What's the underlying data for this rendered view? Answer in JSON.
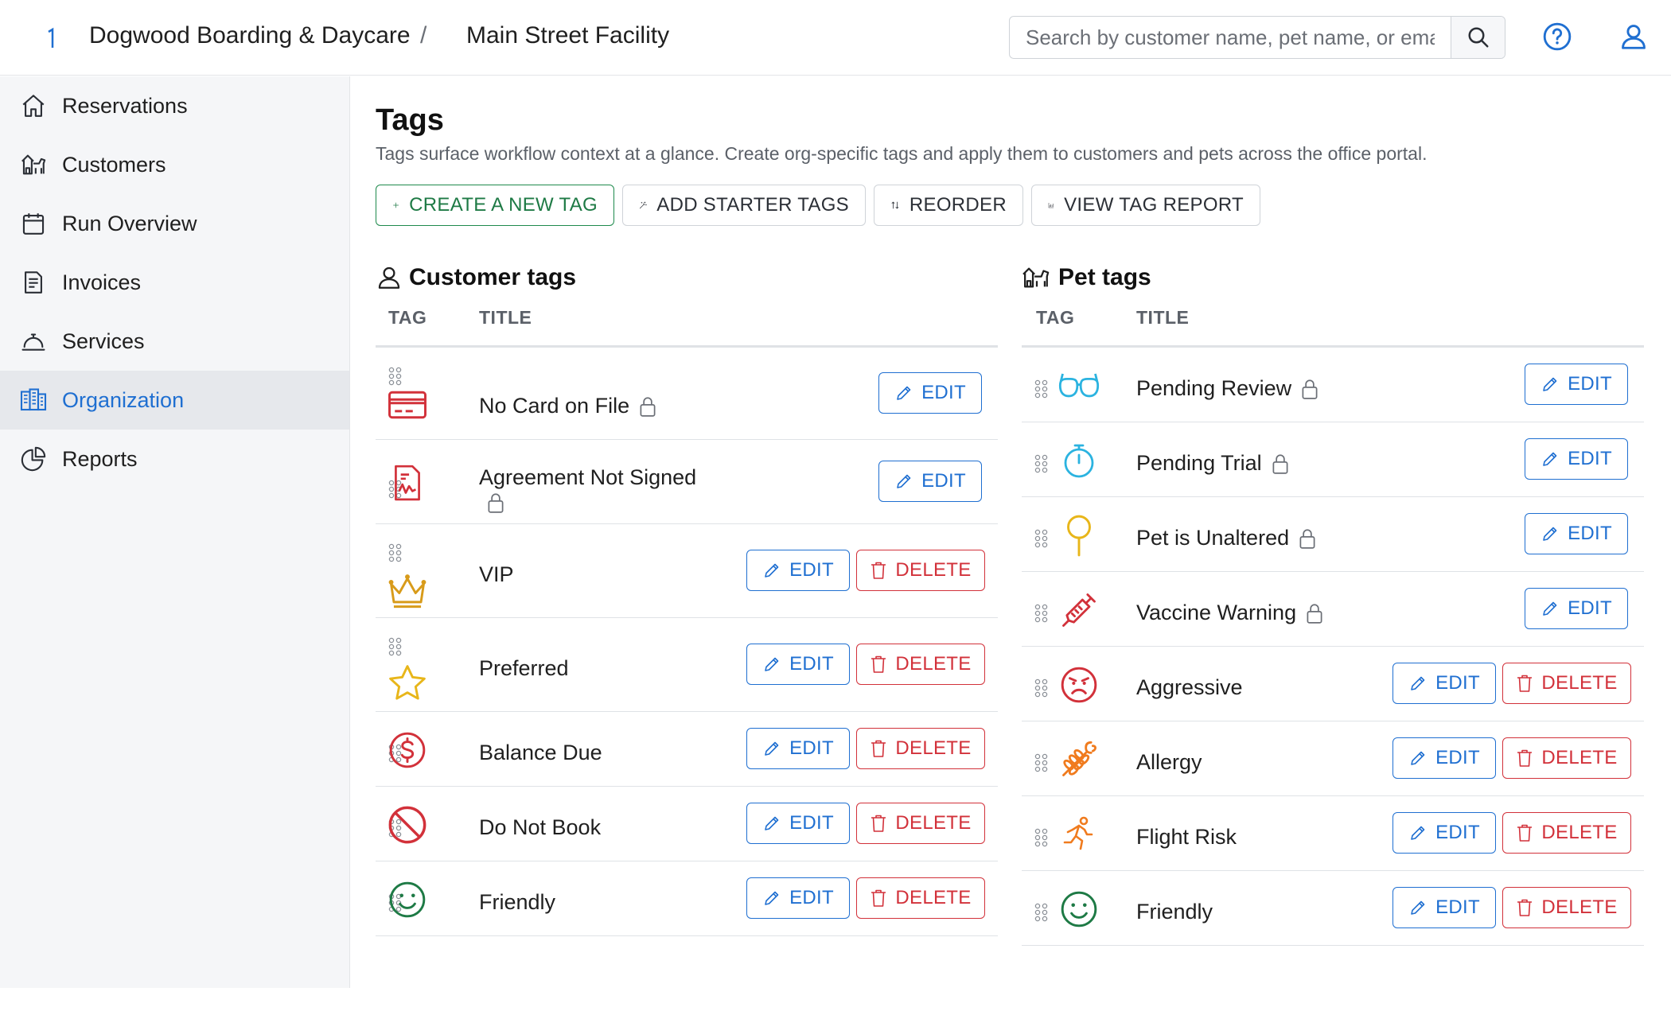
{
  "header": {
    "org_name": "Dogwood Boarding & Daycare",
    "separator": "/",
    "facility": "Main Street Facility",
    "search_placeholder": "Search by customer name, pet name, or email"
  },
  "sidebar": {
    "items": [
      {
        "label": "Reservations",
        "icon": "home-icon"
      },
      {
        "label": "Customers",
        "icon": "dog-house-icon"
      },
      {
        "label": "Run Overview",
        "icon": "calendar-icon"
      },
      {
        "label": "Invoices",
        "icon": "invoice-icon"
      },
      {
        "label": "Services",
        "icon": "service-bell-icon"
      },
      {
        "label": "Organization",
        "icon": "buildings-icon",
        "active": true
      },
      {
        "label": "Reports",
        "icon": "pie-chart-icon"
      }
    ]
  },
  "page": {
    "title": "Tags",
    "description": "Tags surface workflow context at a glance. Create org-specific tags and apply them to customers and pets across the office portal."
  },
  "actions": {
    "create": "CREATE A NEW TAG",
    "starter": "ADD STARTER TAGS",
    "reorder": "REORDER",
    "report": "VIEW TAG REPORT"
  },
  "labels": {
    "edit": "EDIT",
    "delete": "DELETE",
    "col_tag": "TAG",
    "col_title": "TITLE"
  },
  "customer_tags": {
    "title": "Customer tags",
    "rows": [
      {
        "title": "No Card on File",
        "locked": true,
        "icon": "credit-card-icon",
        "color": "#d2313a"
      },
      {
        "title": "Agreement Not Signed",
        "locked": true,
        "icon": "signed-document-icon",
        "color": "#d2313a"
      },
      {
        "title": "VIP",
        "locked": false,
        "icon": "crown-icon",
        "color": "#d89b1a"
      },
      {
        "title": "Preferred",
        "locked": false,
        "icon": "star-icon",
        "color": "#e8b61a"
      },
      {
        "title": "Balance Due",
        "locked": false,
        "icon": "dollar-circle-icon",
        "color": "#d2313a"
      },
      {
        "title": "Do Not Book",
        "locked": false,
        "icon": "prohibited-icon",
        "color": "#d2313a"
      },
      {
        "title": "Friendly",
        "locked": false,
        "icon": "smile-icon",
        "color": "#1e7a45"
      }
    ]
  },
  "pet_tags": {
    "title": "Pet tags",
    "rows": [
      {
        "title": "Pending Review",
        "locked": true,
        "icon": "glasses-icon",
        "color": "#2bb3e0"
      },
      {
        "title": "Pending Trial",
        "locked": true,
        "icon": "stopwatch-icon",
        "color": "#2bb3e0"
      },
      {
        "title": "Pet is Unaltered",
        "locked": true,
        "icon": "pin-icon",
        "color": "#e8b61a"
      },
      {
        "title": "Vaccine Warning",
        "locked": true,
        "icon": "syringe-icon",
        "color": "#d2313a"
      },
      {
        "title": "Aggressive",
        "locked": false,
        "icon": "angry-face-icon",
        "color": "#d2313a"
      },
      {
        "title": "Allergy",
        "locked": false,
        "icon": "wheat-icon",
        "color": "#f07b1e"
      },
      {
        "title": "Flight Risk",
        "locked": false,
        "icon": "running-icon",
        "color": "#f07b1e"
      },
      {
        "title": "Friendly",
        "locked": false,
        "icon": "smile-icon",
        "color": "#1e7a45"
      }
    ]
  },
  "colors": {
    "accent": "#1f6fd1",
    "danger": "#d2313a",
    "success": "#1e7a45"
  }
}
